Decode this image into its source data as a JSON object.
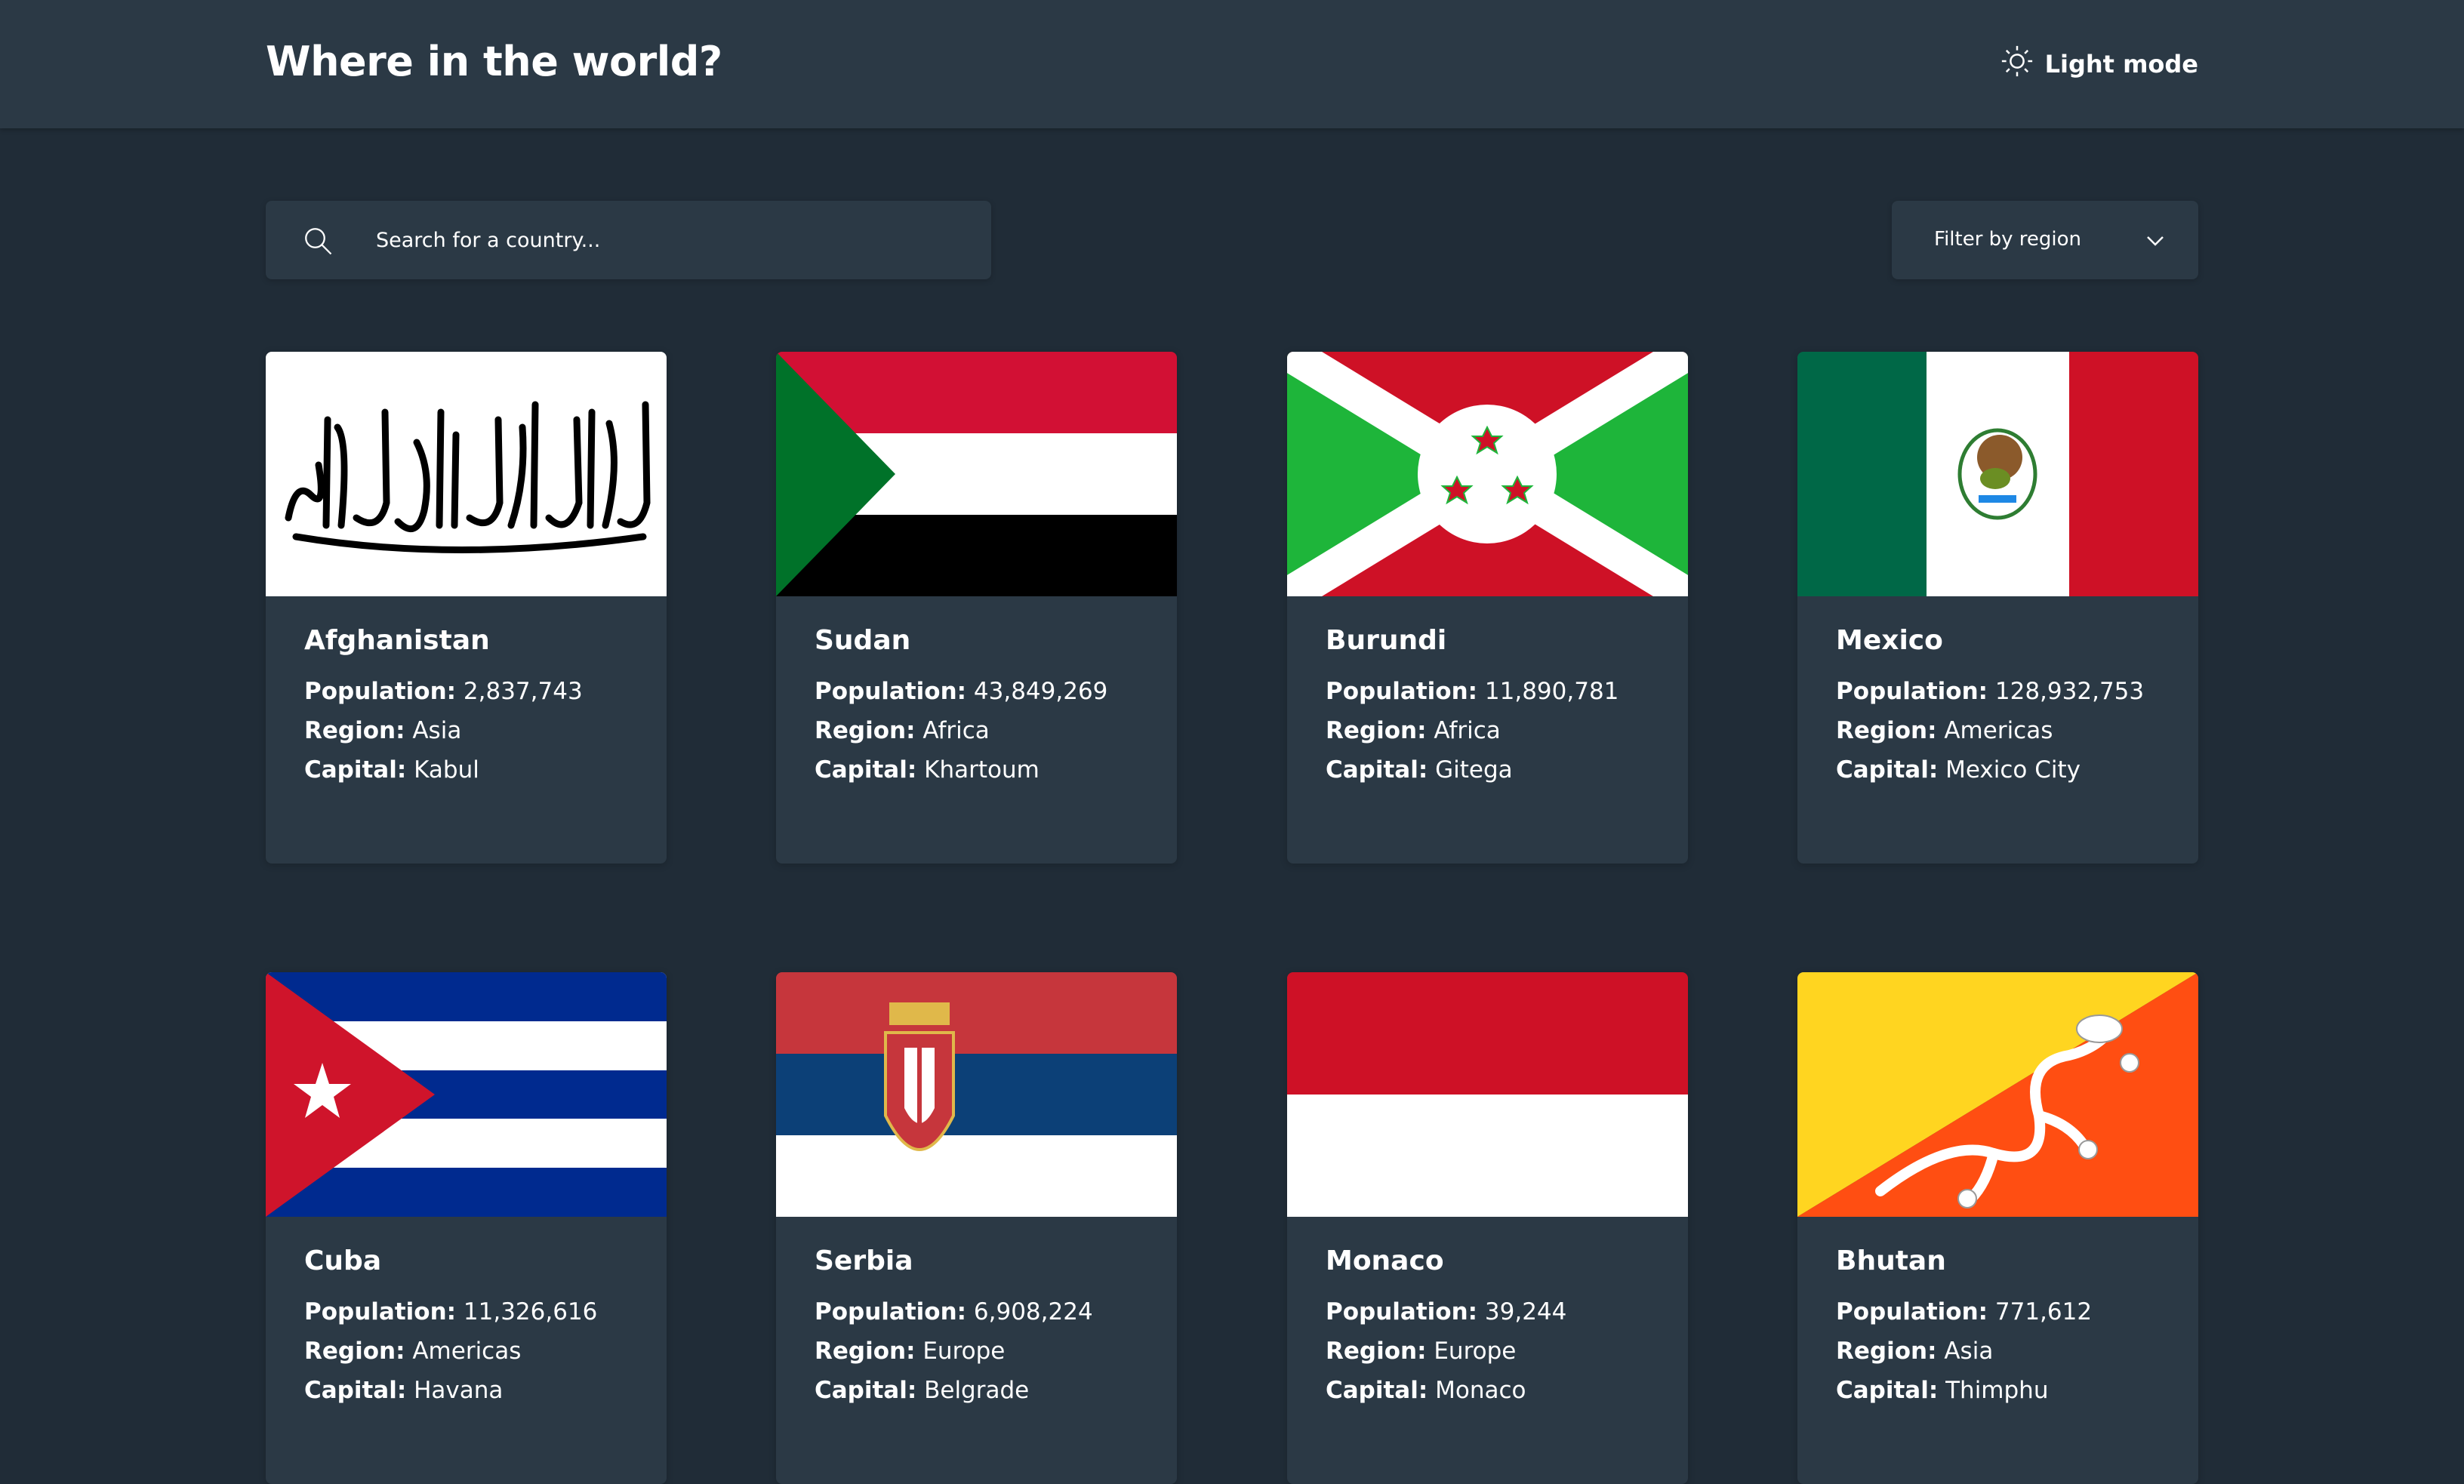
{
  "header": {
    "title": "Where in the world?",
    "theme_toggle_label": "Light mode",
    "theme_icon": "sun-icon"
  },
  "search": {
    "placeholder": "Search for a country...",
    "value": "",
    "icon": "search-icon"
  },
  "filter": {
    "label": "Filter by region",
    "icon": "chevron-down-icon"
  },
  "labels": {
    "population": "Population:",
    "region": "Region:",
    "capital": "Capital:"
  },
  "countries": [
    {
      "name": "Afghanistan",
      "population": "2,837,743",
      "region": "Asia",
      "capital": "Kabul"
    },
    {
      "name": "Sudan",
      "population": "43,849,269",
      "region": "Africa",
      "capital": "Khartoum"
    },
    {
      "name": "Burundi",
      "population": "11,890,781",
      "region": "Africa",
      "capital": "Gitega"
    },
    {
      "name": "Mexico",
      "population": "128,932,753",
      "region": "Americas",
      "capital": "Mexico City"
    },
    {
      "name": "Cuba",
      "population": "11,326,616",
      "region": "Americas",
      "capital": "Havana"
    },
    {
      "name": "Serbia",
      "population": "6,908,224",
      "region": "Europe",
      "capital": "Belgrade"
    },
    {
      "name": "Monaco",
      "population": "39,244",
      "region": "Europe",
      "capital": "Monaco"
    },
    {
      "name": "Bhutan",
      "population": "771,612",
      "region": "Asia",
      "capital": "Thimphu"
    }
  ],
  "colors": {
    "background": "#202c37",
    "element": "#2b3945",
    "text": "#ffffff"
  }
}
